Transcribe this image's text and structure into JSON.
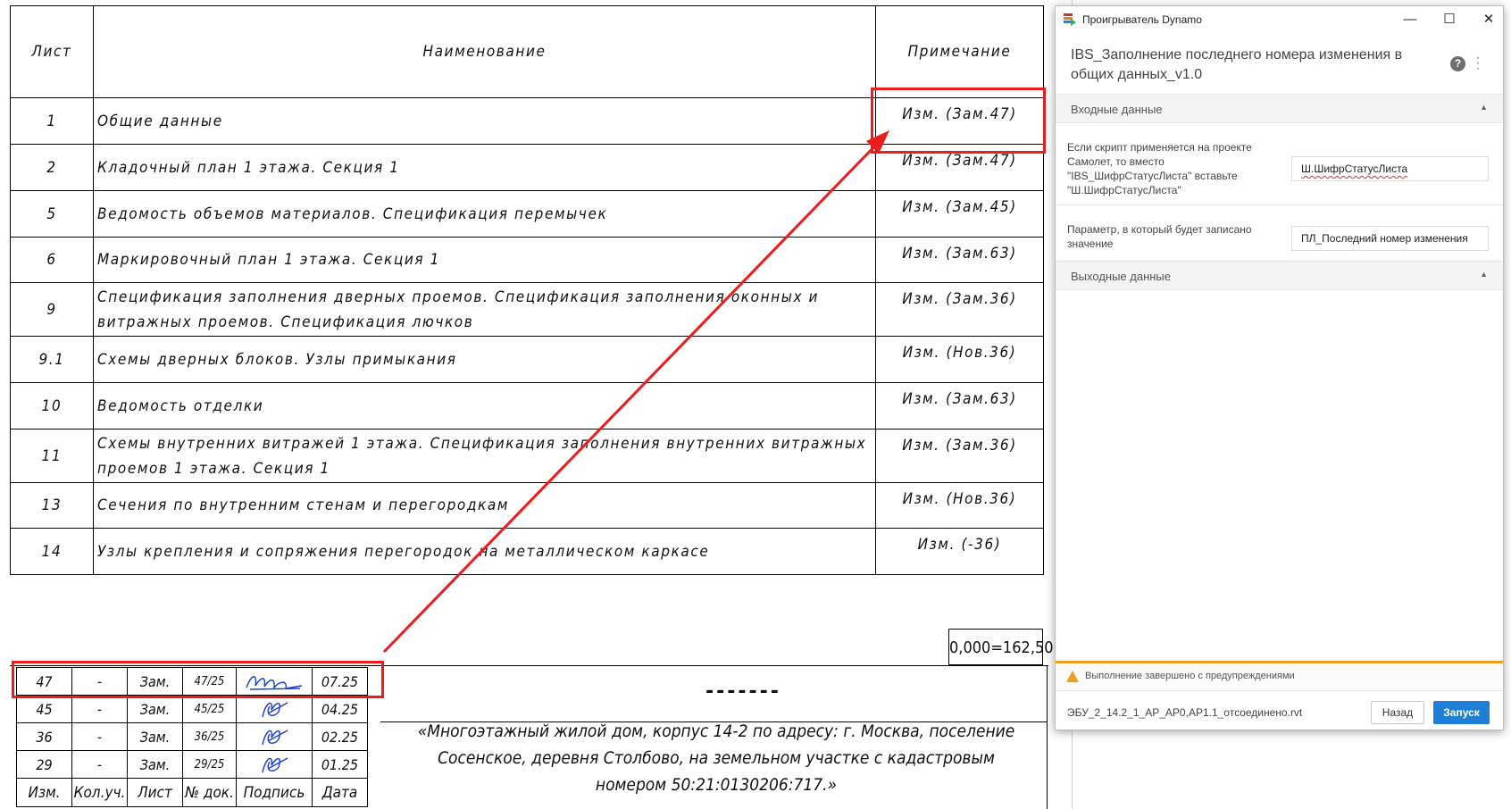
{
  "sheet_list": {
    "headers": {
      "number": "Лист",
      "name": "Наименование",
      "note": "Примечание"
    },
    "rows": [
      {
        "number": "1",
        "name": "Общие данные",
        "note": "Изм. (Зам.47)"
      },
      {
        "number": "2",
        "name": "Кладочный план 1 этажа. Секция 1",
        "note": "Изм. (Зам.47)"
      },
      {
        "number": "5",
        "name": "Ведомость объемов материалов. Спецификация перемычек",
        "note": "Изм. (Зам.45)"
      },
      {
        "number": "6",
        "name": "Маркировочный план 1 этажа. Секция 1",
        "note": "Изм. (Зам.63)"
      },
      {
        "number": "9",
        "name": "Спецификация заполнения дверных проемов. Спецификация заполнения оконных и витражных проемов. Спецификация лючков",
        "note": "Изм. (Зам.36)"
      },
      {
        "number": "9.1",
        "name": "Схемы дверных блоков. Узлы примыкания",
        "note": "Изм. (Нов.36)"
      },
      {
        "number": "10",
        "name": "Ведомость отделки",
        "note": "Изм. (Зам.63)"
      },
      {
        "number": "11",
        "name": "Схемы внутренних витражей 1 этажа. Спецификация заполнения внутренних витражных проемов 1 этажа. Секция 1",
        "note": "Изм. (Зам.36)"
      },
      {
        "number": "13",
        "name": "Сечения по внутренним стенам и перегородкам",
        "note": "Изм. (Нов.36)"
      },
      {
        "number": "14",
        "name": "Узлы крепления и сопряжения перегородок на металлическом каркасе",
        "note": "Изм. (-36)"
      }
    ]
  },
  "scale_text": "0,000=162,50",
  "revisions": {
    "headers": {
      "izm": "Изм.",
      "kol": "Кол.уч.",
      "list": "Лист",
      "doc": "№ док.",
      "sign": "Подпись",
      "date": "Дата"
    },
    "rows": [
      {
        "izm": "47",
        "kol": "-",
        "list": "Зам.",
        "doc": "47/25",
        "date": "07.25"
      },
      {
        "izm": "45",
        "kol": "-",
        "list": "Зам.",
        "doc": "45/25",
        "date": "04.25"
      },
      {
        "izm": "36",
        "kol": "-",
        "list": "Зам.",
        "doc": "36/25",
        "date": "02.25"
      },
      {
        "izm": "29",
        "kol": "-",
        "list": "Зам.",
        "doc": "29/25",
        "date": "01.25"
      }
    ]
  },
  "title_block": {
    "dashes": "-------",
    "project": "«Многоэтажный жилой дом, корпус 14-2 по адресу: г. Москва, поселение Сосенское, деревня Столбово, на земельном участке с кадастровым номером 50:21:0130206:717.»"
  },
  "colors": {
    "highlight": "#ee1c1c",
    "run_button": "#1f7fd6",
    "warning": "#f0a020"
  },
  "player": {
    "window_title": "Проигрыватель Dynamo",
    "script_title": "IBS_Заполнение последнего номера изменения в общих данных_v1.0",
    "inputs_section": "Входные данные",
    "outputs_section": "Выходные данные",
    "params": [
      {
        "label": "Если скрипт применяется на проекте Самолет, то вместо \"IBS_ШифрСтатусЛиста\" вставьте \"Ш.ШифрСтатусЛиста\"",
        "value": "Ш.ШифрСтатусЛиста"
      },
      {
        "label": "Параметр, в который будет записано значение",
        "value": "ПЛ_Последний номер изменения"
      }
    ],
    "status": "Выполнение завершено с предупреждениями",
    "file_name": "ЭБУ_2_14.2_1_АР_АР0,АР1.1_отсоединено.rvt",
    "back_label": "Назад",
    "run_label": "Запуск",
    "icons": {
      "minimize": "minimize-icon",
      "maximize": "maximize-icon",
      "close": "close-icon",
      "help": "help-icon",
      "menu": "kebab-menu-icon",
      "warning": "warning-icon"
    }
  }
}
